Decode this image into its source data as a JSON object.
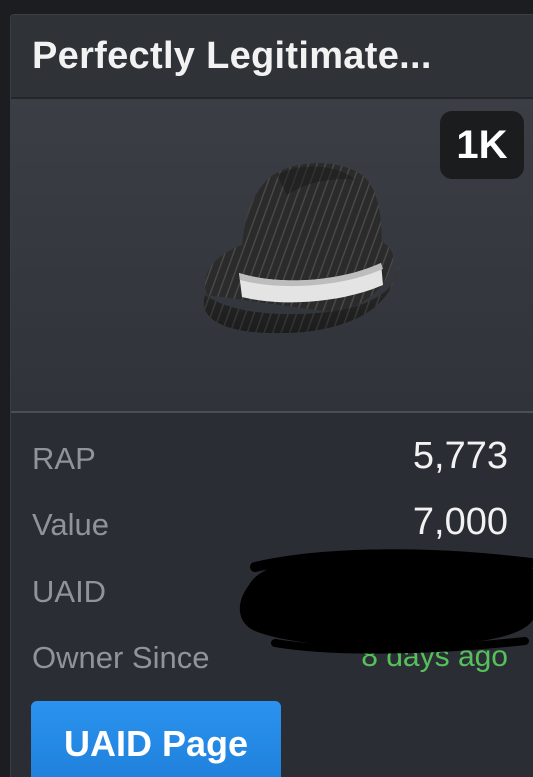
{
  "item": {
    "title": "Perfectly Legitimate...",
    "badge": "1K",
    "thumbnail_icon": "fedora-hat-icon"
  },
  "stats": {
    "rap_label": "RAP",
    "rap_value": "5,773",
    "value_label": "Value",
    "value_value": "7,000",
    "uaid_label": "UAID",
    "uaid_value": "",
    "owner_since_label": "Owner Since",
    "owner_since_value": "8 days ago"
  },
  "actions": {
    "uaid_page_label": "UAID Page"
  },
  "colors": {
    "card_bg": "#2a2d33",
    "accent_blue": "#1e88e5",
    "positive_green": "#56c15a",
    "muted_label": "#8f949b"
  }
}
